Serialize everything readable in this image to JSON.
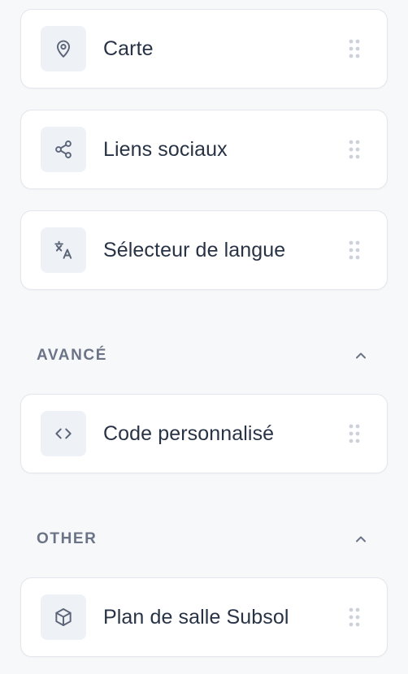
{
  "colors": {
    "page_background": "#f7f8fa",
    "card_background": "#ffffff",
    "card_border": "#e3e6ec",
    "icon_background": "#eef1f6",
    "icon_color": "#5b6577",
    "label_color": "#283346",
    "section_title_color": "#6b7486",
    "handle_color": "#cdd2da"
  },
  "cards": [
    {
      "label": "Carte",
      "icon": "map-pin-icon"
    },
    {
      "label": "Liens sociaux",
      "icon": "share-icon"
    },
    {
      "label": "Sélecteur de langue",
      "icon": "translate-icon"
    }
  ],
  "sections": [
    {
      "title": "AVANCÉ",
      "expanded": true,
      "chevron": "chevron-up-icon",
      "cards": [
        {
          "label": "Code personnalisé",
          "icon": "code-icon"
        }
      ]
    },
    {
      "title": "OTHER",
      "expanded": true,
      "chevron": "chevron-up-icon",
      "cards": [
        {
          "label": "Plan de salle Subsol",
          "icon": "cube-icon"
        }
      ]
    }
  ]
}
